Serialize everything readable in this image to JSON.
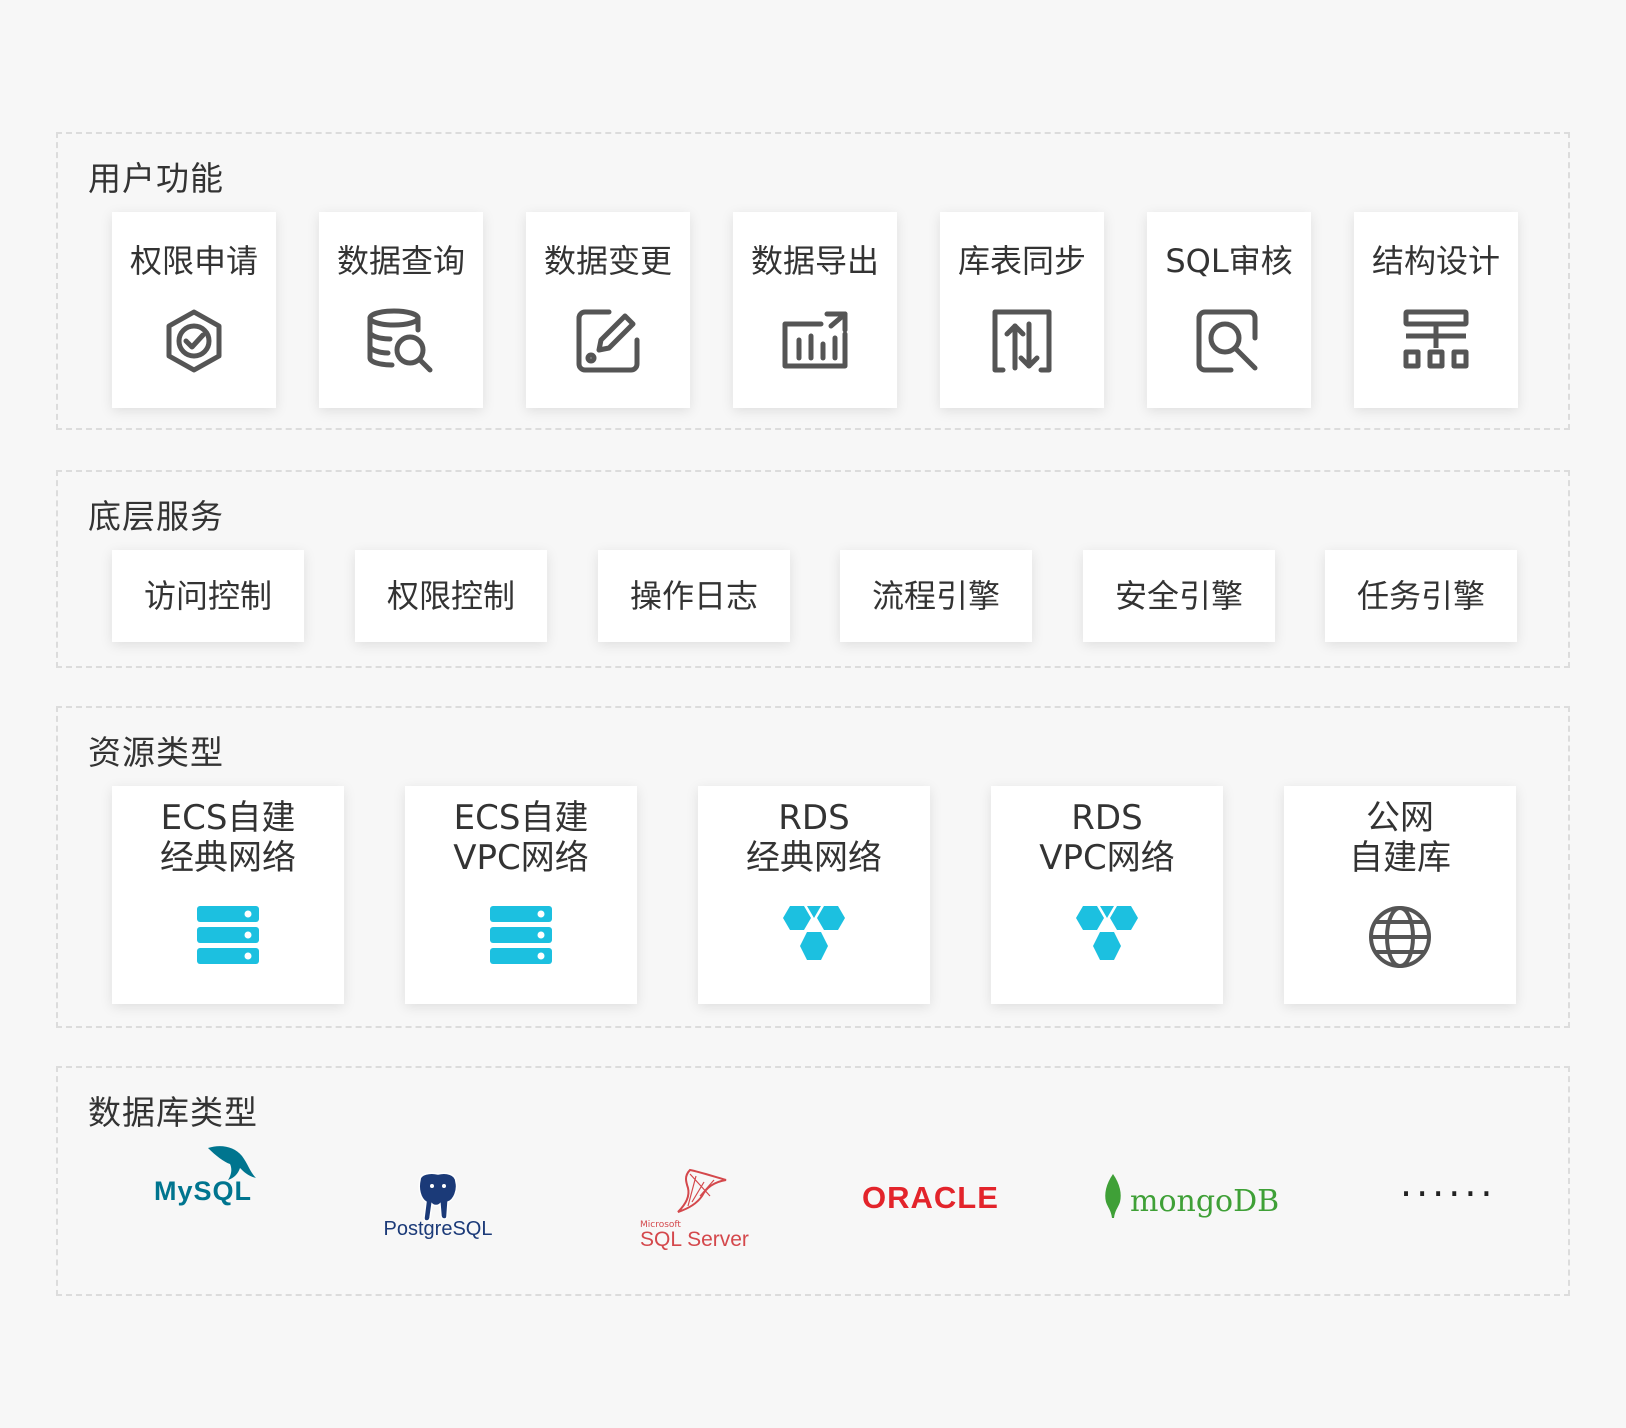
{
  "sections": {
    "functions": {
      "title": "用户功能",
      "items": [
        {
          "label": "权限申请",
          "icon": "shield-check-icon"
        },
        {
          "label": "数据查询",
          "icon": "database-search-icon"
        },
        {
          "label": "数据变更",
          "icon": "edit-icon"
        },
        {
          "label": "数据导出",
          "icon": "chart-export-icon"
        },
        {
          "label": "库表同步",
          "icon": "sync-arrows-icon"
        },
        {
          "label": "SQL审核",
          "icon": "magnifier-audit-icon"
        },
        {
          "label": "结构设计",
          "icon": "structure-icon"
        }
      ]
    },
    "services": {
      "title": "底层服务",
      "items": [
        "访问控制",
        "权限控制",
        "操作日志",
        "流程引擎",
        "安全引擎",
        "任务引擎"
      ]
    },
    "resources": {
      "title": "资源类型",
      "items": [
        {
          "line1": "ECS自建",
          "line2": "经典网络",
          "icon": "server-icon"
        },
        {
          "line1": "ECS自建",
          "line2": "VPC网络",
          "icon": "server-icon"
        },
        {
          "line1": "RDS",
          "line2": "经典网络",
          "icon": "rds-icon"
        },
        {
          "line1": "RDS",
          "line2": "VPC网络",
          "icon": "rds-icon"
        },
        {
          "line1": "公网",
          "line2": "自建库",
          "icon": "globe-icon"
        }
      ]
    },
    "databases": {
      "title": "数据库类型",
      "logos": {
        "mysql": "MySQL",
        "postgres": "PostgreSQL",
        "sqlserver_small": "Microsoft",
        "sqlserver": "SQL Server",
        "oracle": "ORACLE",
        "mongodb": "mongoDB"
      },
      "more": "······"
    }
  },
  "colors": {
    "accent": "#1cc0e0",
    "icon_gray": "#555555",
    "mysql": "#00758f",
    "postgres": "#1b3a78",
    "sqlserver": "#d4484c",
    "oracle": "#e3242b",
    "mongodb": "#3fa037"
  }
}
